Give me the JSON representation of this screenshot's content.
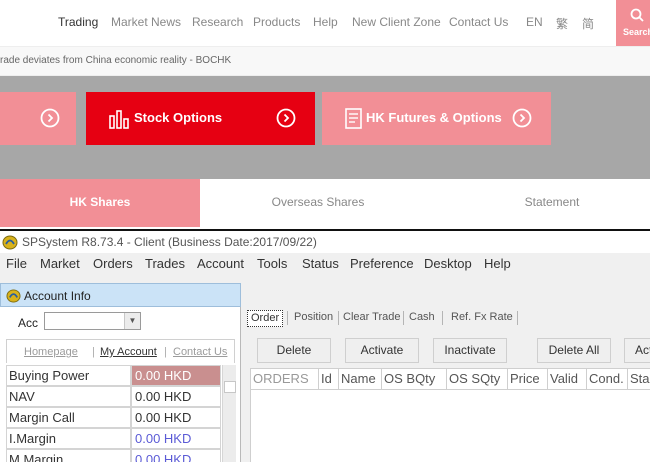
{
  "site": {
    "nav": [
      "Trading",
      "Market News",
      "Research",
      "Products",
      "Help",
      "New Client Zone",
      "Contact Us",
      "EN",
      "繁",
      "简"
    ],
    "search_label": "Search",
    "ticker": "rade deviates from China economic reality - BOCHK",
    "tiles": [
      {
        "label": "",
        "icon": "arrow-circle-icon"
      },
      {
        "label": "Stock Options",
        "icon": "bar-chart-icon"
      },
      {
        "label": "HK Futures & Options",
        "icon": "document-icon"
      }
    ],
    "tabs": [
      "HK Shares",
      "Overseas Shares",
      "Statement"
    ],
    "colors": {
      "accent_red": "#e60012",
      "pink": "#f28f96",
      "banner_gray": "#a7a7a7"
    }
  },
  "app": {
    "title": "SPSystem R8.73.4 - Client (Business Date:2017/09/22)",
    "menu": [
      "File",
      "Market",
      "Orders",
      "Trades",
      "Account",
      "Tools",
      "Status",
      "Preference",
      "Desktop",
      "Help"
    ],
    "panel_title": "Account Info",
    "acc_label": "Acc",
    "acc_value": "",
    "links": [
      "Homepage",
      "My Account",
      "Contact Us"
    ],
    "rows": [
      {
        "label": "Buying Power",
        "value": "0.00 HKD"
      },
      {
        "label": "NAV",
        "value": "0.00 HKD"
      },
      {
        "label": "Margin Call",
        "value": "0.00 HKD"
      },
      {
        "label": "I.Margin",
        "value": "0.00 HKD"
      },
      {
        "label": "M.Margin",
        "value": "0.00 HKD"
      }
    ],
    "sub_tabs": [
      "Order",
      "Position",
      "Clear Trade",
      "Cash",
      "Ref. Fx Rate"
    ],
    "actions": [
      "Delete",
      "Activate",
      "Inactivate",
      "Delete All",
      "Act"
    ],
    "columns": [
      "ORDERS",
      "Id",
      "Name",
      "OS BQty",
      "OS SQty",
      "Price",
      "Valid",
      "Cond.",
      "Sta"
    ]
  }
}
